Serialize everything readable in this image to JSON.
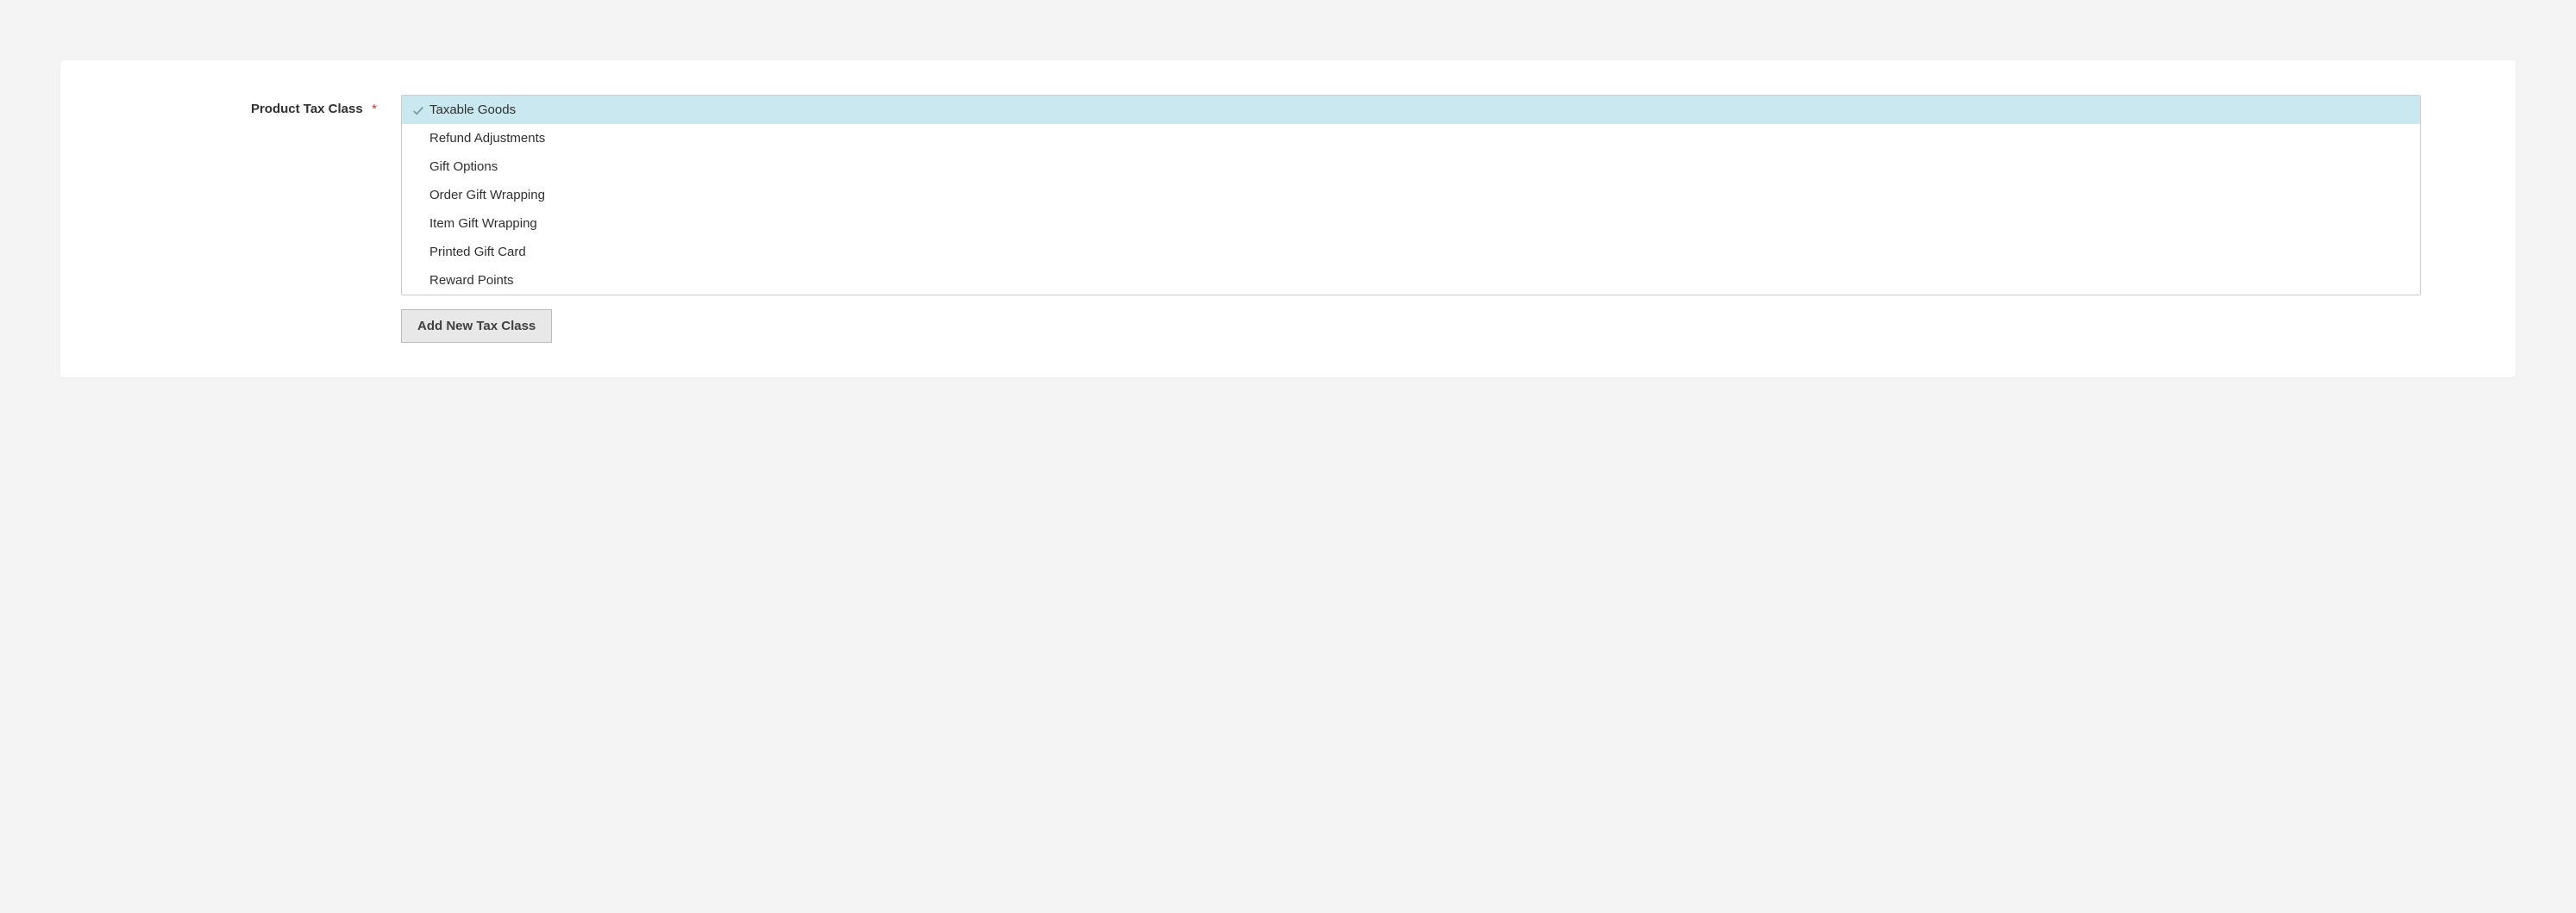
{
  "form": {
    "label": "Product Tax Class",
    "required_marker": "*",
    "options": [
      {
        "label": "Taxable Goods",
        "selected": true
      },
      {
        "label": "Refund Adjustments",
        "selected": false
      },
      {
        "label": "Gift Options",
        "selected": false
      },
      {
        "label": "Order Gift Wrapping",
        "selected": false
      },
      {
        "label": "Item Gift Wrapping",
        "selected": false
      },
      {
        "label": "Printed Gift Card",
        "selected": false
      },
      {
        "label": "Reward Points",
        "selected": false
      }
    ],
    "add_button_label": "Add New Tax Class"
  }
}
